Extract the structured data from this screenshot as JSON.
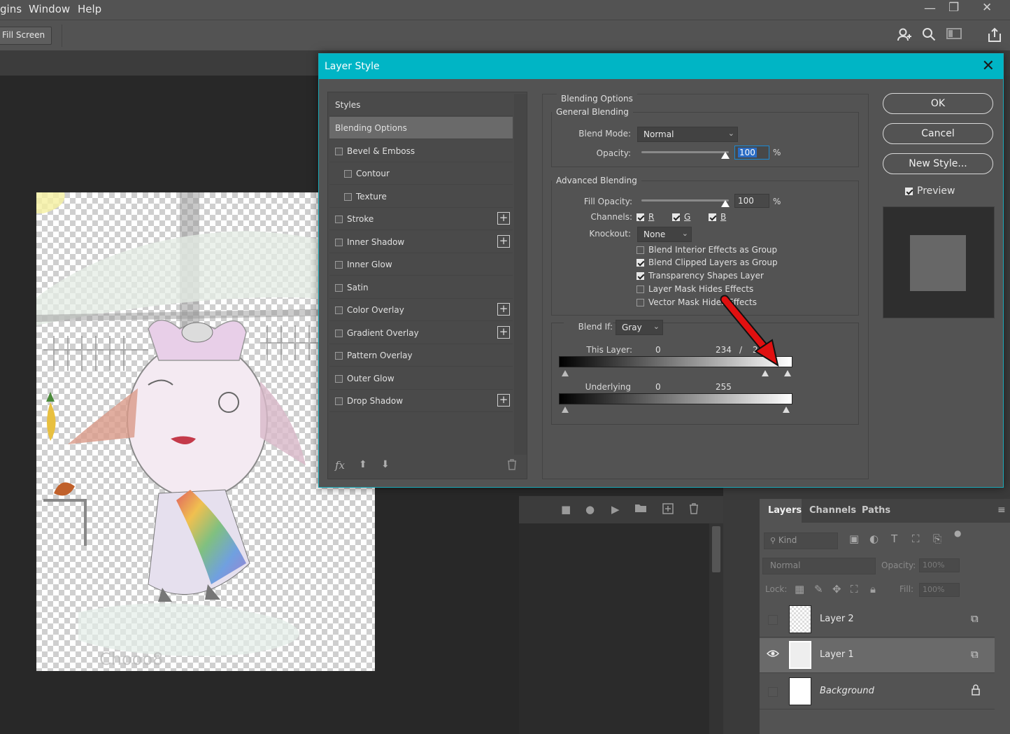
{
  "menu": {
    "items": [
      "gins",
      "Window",
      "Help"
    ],
    "window_controls": [
      "—",
      "❐",
      "✕"
    ]
  },
  "options_bar": {
    "fill_screen": "Fill Screen"
  },
  "dialog": {
    "title": "Layer Style",
    "close": "✕",
    "styles_header": "Styles",
    "style_items": [
      {
        "label": "Blending Options"
      },
      {
        "label": "Bevel & Emboss"
      },
      {
        "label": "Contour"
      },
      {
        "label": "Texture"
      },
      {
        "label": "Stroke"
      },
      {
        "label": "Inner Shadow"
      },
      {
        "label": "Inner Glow"
      },
      {
        "label": "Satin"
      },
      {
        "label": "Color Overlay"
      },
      {
        "label": "Gradient Overlay"
      },
      {
        "label": "Pattern Overlay"
      },
      {
        "label": "Outer Glow"
      },
      {
        "label": "Drop Shadow"
      }
    ],
    "footer_fx": "fx",
    "blending_options": "Blending Options",
    "general_blending": {
      "legend": "General Blending",
      "blend_mode_label": "Blend Mode:",
      "blend_mode_value": "Normal",
      "opacity_label": "Opacity:",
      "opacity_value": "100",
      "unit": "%"
    },
    "advanced_blending": {
      "legend": "Advanced Blending",
      "fill_opacity_label": "Fill Opacity:",
      "fill_opacity_value": "100",
      "unit": "%",
      "channels_label": "Channels:",
      "channels": [
        "R",
        "G",
        "B"
      ],
      "knockout_label": "Knockout:",
      "knockout_value": "None",
      "options": [
        {
          "label": "Blend Interior Effects as Group",
          "checked": false
        },
        {
          "label": "Blend Clipped Layers as Group",
          "checked": true
        },
        {
          "label": "Transparency Shapes Layer",
          "checked": true
        },
        {
          "label": "Layer Mask Hides Effects",
          "checked": false
        },
        {
          "label": "Vector Mask Hides Effects",
          "checked": false
        }
      ]
    },
    "blend_if": {
      "label": "Blend If:",
      "value": "Gray",
      "this_layer_label": "This Layer:",
      "this_layer_values": [
        "0",
        "234",
        "/",
        "2"
      ],
      "underlying_label": "Underlying Layer:",
      "underlying_values": [
        "0",
        "255"
      ]
    },
    "buttons": {
      "ok": "OK",
      "cancel": "Cancel",
      "new_style": "New Style...",
      "preview": "Preview"
    }
  },
  "layers_panel": {
    "tabs": [
      "Layers",
      "Channels",
      "Paths"
    ],
    "kind": "Kind",
    "blend_mode": "Normal",
    "opacity_label": "Opacity:",
    "opacity_value": "100%",
    "lock_label": "Lock:",
    "fill_label": "Fill:",
    "fill_value": "100%",
    "layers": [
      {
        "name": "Layer 2",
        "visible": false,
        "selected": false
      },
      {
        "name": "Layer 1",
        "visible": true,
        "selected": true
      },
      {
        "name": "Background",
        "visible": false,
        "selected": false
      }
    ]
  }
}
